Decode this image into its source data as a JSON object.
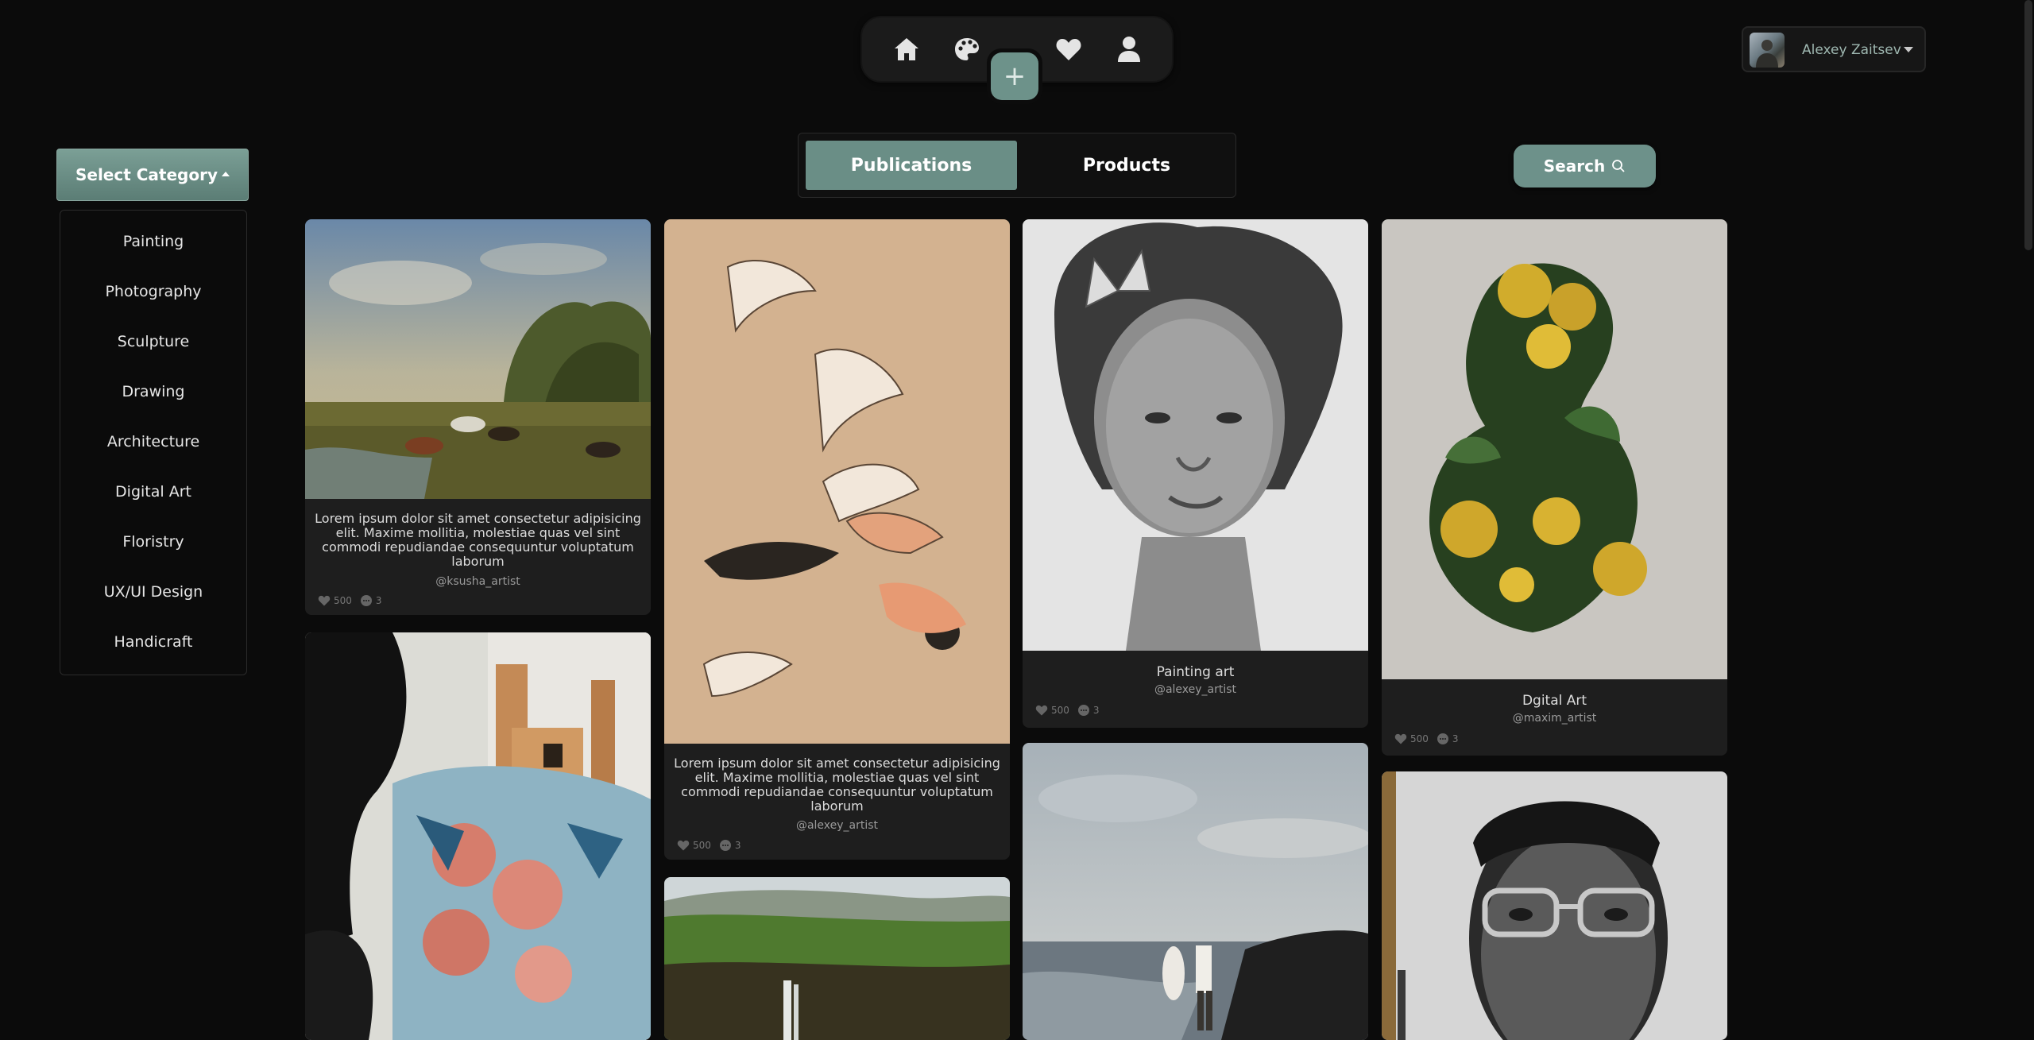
{
  "nav": {
    "icons": [
      "home-icon",
      "palette-icon",
      "heart-icon",
      "user-icon"
    ],
    "plus_label": "+"
  },
  "user": {
    "name": "Alexey Zaitsev"
  },
  "category": {
    "button_label": "Select Category",
    "items": [
      "Painting",
      "Photography",
      "Sculpture",
      "Drawing",
      "Architecture",
      "Digital Art",
      "Floristry",
      "UX/UI Design",
      "Handicraft"
    ]
  },
  "tabs": {
    "publications": "Publications",
    "products": "Products"
  },
  "search": {
    "label": "Search"
  },
  "cards": [
    {
      "text": "Lorem ipsum dolor sit amet consectetur adipisicing elit. Maxime mollitia, molestiae quas vel sint commodi repudiandae consequuntur voluptatum laborum",
      "handle": "@ksusha_artist",
      "likes": "500",
      "comments": "3"
    },
    {
      "text": "Lorem ipsum dolor sit amet consectetur adipisicing elit. Maxime mollitia, molestiae quas vel sint commodi repudiandae consequuntur voluptatum laborum",
      "handle": "@alexey_artist",
      "likes": "500",
      "comments": "3"
    },
    {
      "title": "Painting art",
      "handle": "@alexey_artist",
      "likes": "500",
      "comments": "3"
    },
    {
      "title": "Dgital Art",
      "handle": "@maxim_artist",
      "likes": "500",
      "comments": "3"
    }
  ],
  "colors": {
    "accent": "#6a8e86",
    "background": "#0b0b0b",
    "card": "#1e1e1e"
  }
}
